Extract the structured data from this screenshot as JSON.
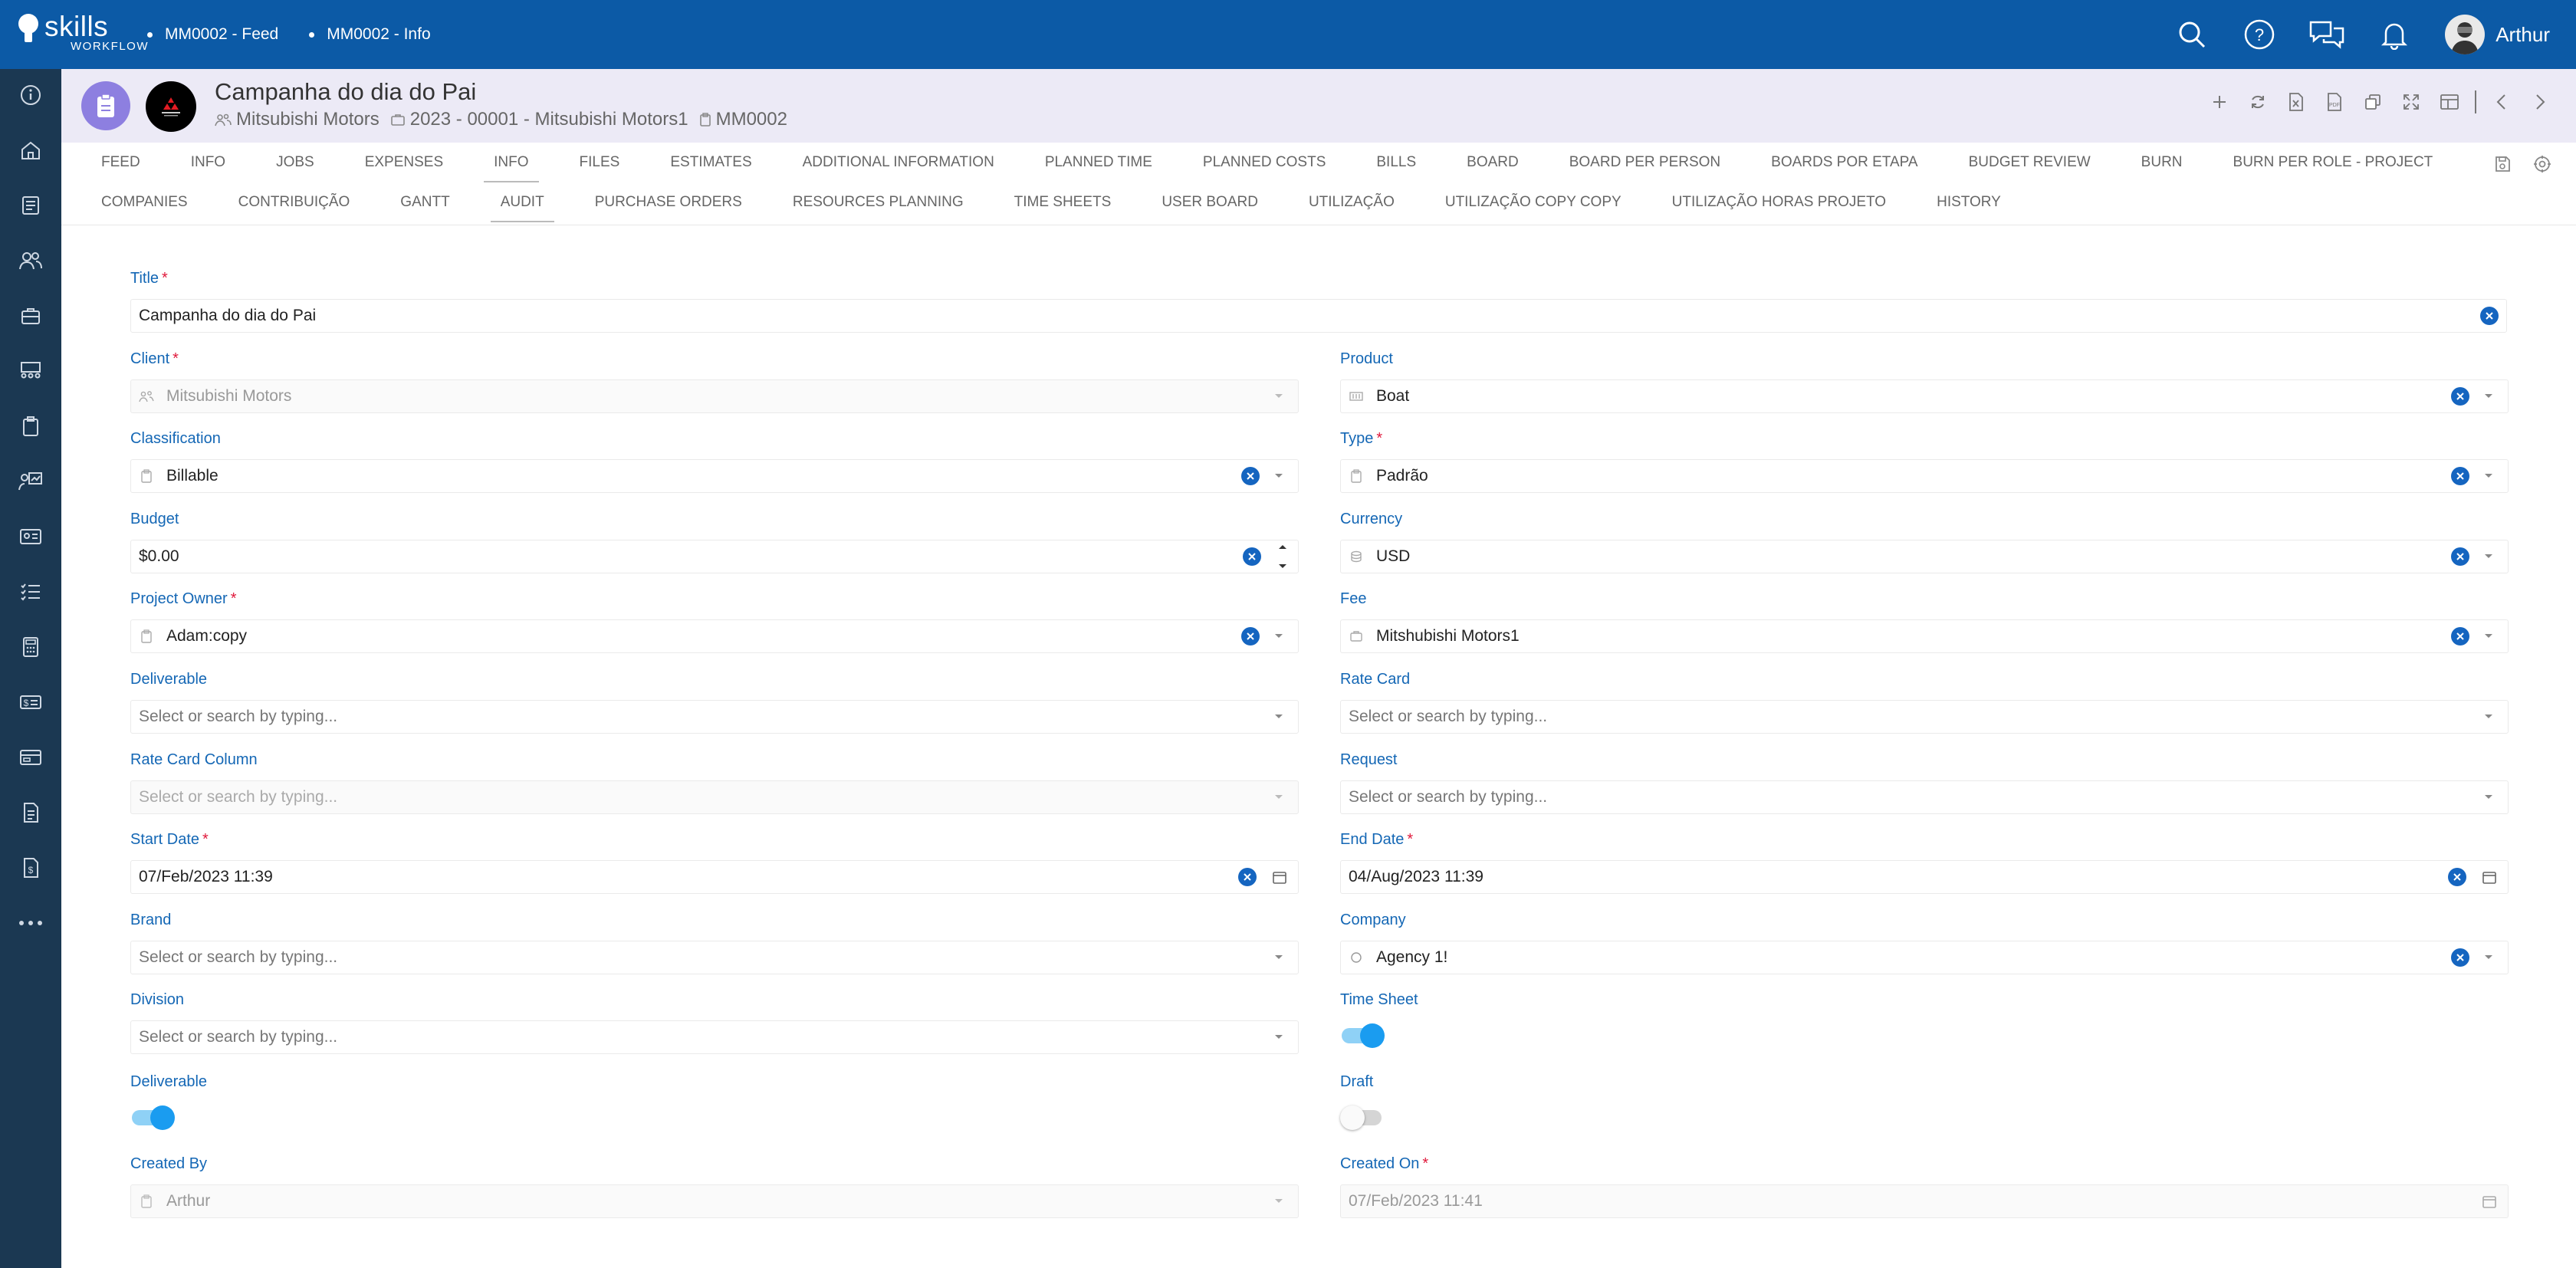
{
  "app": {
    "logo_main": "skills",
    "logo_sub": "WORKFLOW"
  },
  "breadcrumbs": [
    "MM0002 - Feed",
    "MM0002 - Info"
  ],
  "user": {
    "name": "Arthur"
  },
  "project": {
    "title": "Campanha do dia do Pai",
    "client": "Mitsubishi Motors",
    "fee": "2023 - 00001 - Mitsubishi Motors1",
    "code": "MM0002"
  },
  "tabs_row1": [
    "FEED",
    "INFO",
    "JOBS",
    "EXPENSES",
    "INFO",
    "FILES",
    "ESTIMATES",
    "ADDITIONAL INFORMATION",
    "PLANNED TIME",
    "PLANNED COSTS",
    "BILLS",
    "BOARD",
    "BOARD PER PERSON",
    "BOARDS POR ETAPA",
    "BUDGET REVIEW",
    "BURN",
    "BURN PER ROLE - PROJECT"
  ],
  "tabs_row2": [
    "COMPANIES",
    "CONTRIBUIÇÃO",
    "GANTT",
    "AUDIT",
    "PURCHASE ORDERS",
    "RESOURCES PLANNING",
    "TIME SHEETS",
    "USER BOARD",
    "UTILIZAÇÃO",
    "UTILIZAÇÃO COPY COPY",
    "UTILIZAÇÃO HORAS PROJETO",
    "HISTORY"
  ],
  "form": {
    "title": {
      "label": "Title",
      "value": "Campanha do dia do Pai"
    },
    "client": {
      "label": "Client",
      "value": "Mitsubishi Motors"
    },
    "product": {
      "label": "Product",
      "value": "Boat"
    },
    "classification": {
      "label": "Classification",
      "value": "Billable"
    },
    "type": {
      "label": "Type",
      "value": "Padrão"
    },
    "budget": {
      "label": "Budget",
      "value": "$0.00"
    },
    "currency": {
      "label": "Currency",
      "value": "USD"
    },
    "project_owner": {
      "label": "Project Owner",
      "value": "Adam:copy"
    },
    "fee": {
      "label": "Fee",
      "value": "Mitshubishi Motors1"
    },
    "deliverable_select": {
      "label": "Deliverable",
      "placeholder": "Select or search by typing..."
    },
    "rate_card": {
      "label": "Rate Card",
      "placeholder": "Select or search by typing..."
    },
    "rate_card_column": {
      "label": "Rate Card Column",
      "placeholder": "Select or search by typing..."
    },
    "request": {
      "label": "Request",
      "placeholder": "Select or search by typing..."
    },
    "start_date": {
      "label": "Start Date",
      "value": "07/Feb/2023 11:39"
    },
    "end_date": {
      "label": "End Date",
      "value": "04/Aug/2023 11:39"
    },
    "brand": {
      "label": "Brand",
      "placeholder": "Select or search by typing..."
    },
    "company": {
      "label": "Company",
      "value": "Agency 1!"
    },
    "division": {
      "label": "Division",
      "placeholder": "Select or search by typing..."
    },
    "time_sheet": {
      "label": "Time Sheet",
      "on": true
    },
    "deliverable_toggle": {
      "label": "Deliverable",
      "on": true
    },
    "draft": {
      "label": "Draft",
      "on": false
    },
    "created_by": {
      "label": "Created By",
      "value": "Arthur"
    },
    "created_on": {
      "label": "Created On",
      "value": "07/Feb/2023 11:41"
    }
  },
  "colors": {
    "topbar": "#0c5aa6",
    "sidebar": "#1b3852",
    "label": "#1467b5",
    "required": "#e0193b",
    "clear": "#1565c0",
    "toggle_on": "#1a9cf0"
  },
  "icons": {
    "sidebar": [
      "info-icon",
      "home-icon",
      "document-icon",
      "people-icon",
      "briefcase-icon",
      "meeting-icon",
      "clipboard-icon",
      "presentation-icon",
      "id-card-icon",
      "checklist-icon",
      "calculator-icon",
      "dollar-card-icon",
      "payment-icon",
      "invoice-icon",
      "receipt-icon",
      "more-icon"
    ],
    "top": [
      "search-icon",
      "help-icon",
      "chat-icon",
      "bell-icon"
    ],
    "header_actions": [
      "add-icon",
      "refresh-icon",
      "excel-icon",
      "pdf-icon",
      "copy-icon",
      "expand-icon",
      "layout-icon",
      "prev-icon",
      "next-icon"
    ]
  }
}
